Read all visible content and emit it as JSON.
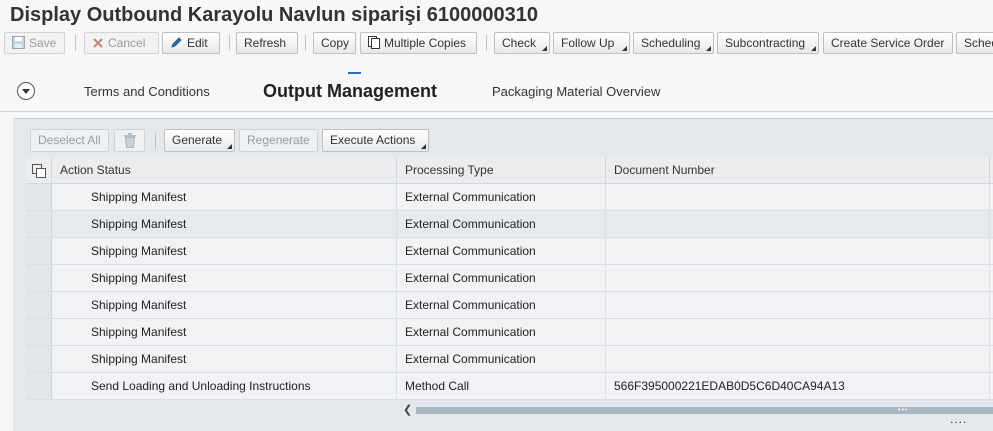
{
  "title": "Display Outbound Karayolu Navlun siparişi 6100000310",
  "toolbar": {
    "save": "Save",
    "cancel": "Cancel",
    "edit": "Edit",
    "refresh": "Refresh",
    "copy": "Copy",
    "multiple_copies": "Multiple Copies",
    "check": "Check",
    "follow_up": "Follow Up",
    "scheduling": "Scheduling",
    "subcontracting": "Subcontracting",
    "create_service_order": "Create Service Order",
    "overflow": "Sched"
  },
  "tabs": {
    "terms": "Terms and Conditions",
    "output": "Output Management",
    "packaging": "Packaging Material Overview",
    "active": "Output Management"
  },
  "table_toolbar": {
    "deselect_all": "Deselect All",
    "delete_icon": "trash-icon",
    "generate": "Generate",
    "regenerate": "Regenerate",
    "execute_actions": "Execute Actions"
  },
  "columns": {
    "action_status": "Action Status",
    "processing_type": "Processing Type",
    "document_number": "Document Number"
  },
  "rows": [
    {
      "action": "Shipping Manifest",
      "type": "External Communication",
      "doc": ""
    },
    {
      "action": "Shipping Manifest",
      "type": "External Communication",
      "doc": ""
    },
    {
      "action": "Shipping Manifest",
      "type": "External Communication",
      "doc": ""
    },
    {
      "action": "Shipping Manifest",
      "type": "External Communication",
      "doc": ""
    },
    {
      "action": "Shipping Manifest",
      "type": "External Communication",
      "doc": ""
    },
    {
      "action": "Shipping Manifest",
      "type": "External Communication",
      "doc": ""
    },
    {
      "action": "Shipping Manifest",
      "type": "External Communication",
      "doc": ""
    },
    {
      "action": "Send Loading and Unloading Instructions",
      "type": "Method Call",
      "doc": "566F395000221EDAB0D5C6D40CA94A13"
    }
  ],
  "colors": {
    "accent": "#2a6fb5",
    "panel_bg": "#e4e8ec",
    "scroll_thumb": "#a9b6c3"
  },
  "footer_dots": "...."
}
